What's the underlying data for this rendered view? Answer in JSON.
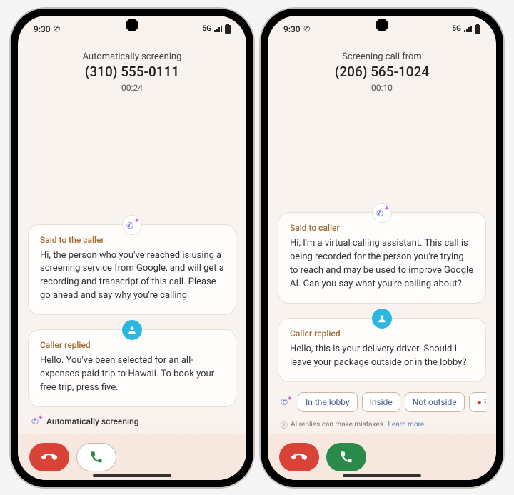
{
  "statusbar": {
    "time": "9:30",
    "network": "5G"
  },
  "phones": [
    {
      "header": {
        "title": "Automatically screening",
        "number": "(310) 555-0111",
        "timer": "00:24"
      },
      "cards": [
        {
          "icon": "ai",
          "label": "Said to the caller",
          "text": "Hi, the person who you've reached is using a screening service from Google, and will get a recording and transcript of this call. Please go ahead and say why you're calling."
        },
        {
          "icon": "caller",
          "label": "Caller replied",
          "text": "Hello. You've been selected for an all-expenses paid trip to Hawaii. To book your free trip, press five."
        }
      ],
      "status_line": "Automatically screening",
      "answer_style": "outline"
    },
    {
      "header": {
        "title": "Screening call from",
        "number": "(206) 565-1024",
        "timer": "00:10"
      },
      "cards": [
        {
          "icon": "ai",
          "label": "Said to caller",
          "text": "Hi, I'm a virtual calling assistant. This call is being recorded for the person you're trying to reach and may be used to improve Google AI. Can you say what you're calling about?"
        },
        {
          "icon": "caller",
          "label": "Caller replied",
          "text": "Hello, this is your delivery driver. Should I leave your package outside or in the lobby?"
        }
      ],
      "chips": [
        "In the lobby",
        "Inside",
        "Not outside"
      ],
      "chip_cut": "Rep",
      "disclaimer": {
        "text": "AI replies can make mistakes.",
        "link": "Learn more"
      },
      "answer_style": "fill"
    }
  ]
}
